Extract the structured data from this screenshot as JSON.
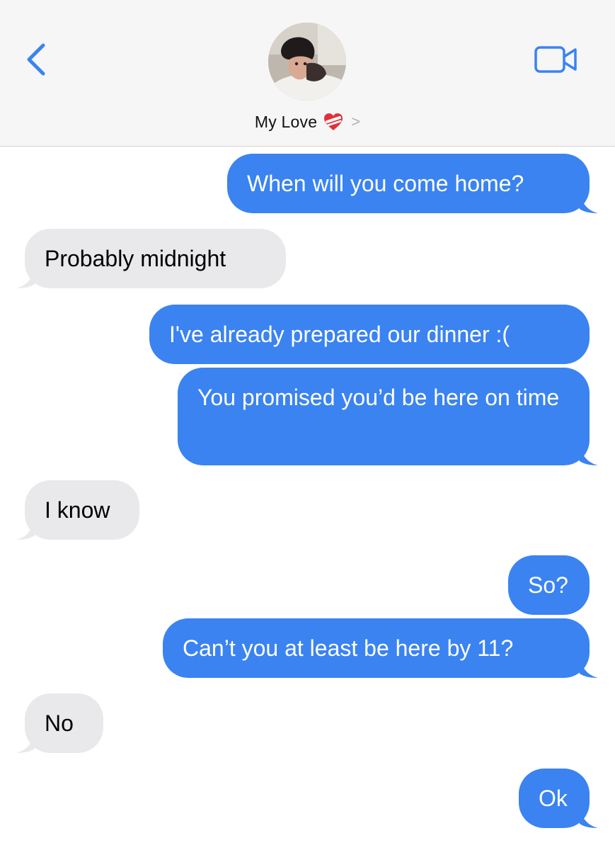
{
  "header": {
    "contact_name": "My Love",
    "back_icon": "chevron-left-icon",
    "video_icon": "video-camera-icon",
    "heart_icon": "mending-heart-emoji-icon",
    "disclosure_icon": "chevron-right-icon",
    "disclosure_glyph": ">",
    "accent_color": "#3a83f1"
  },
  "messages": [
    {
      "direction": "sent",
      "text": "When will you come home?"
    },
    {
      "direction": "received",
      "text": "Probably midnight"
    },
    {
      "direction": "sent",
      "text": "I've already prepared our dinner :("
    },
    {
      "direction": "sent",
      "text": "You promised you’d be here on time"
    },
    {
      "direction": "received",
      "text": "I know"
    },
    {
      "direction": "sent",
      "text": "So?"
    },
    {
      "direction": "sent",
      "text": "Can’t you at least be here by 11?"
    },
    {
      "direction": "received",
      "text": "No"
    },
    {
      "direction": "sent",
      "text": "Ok"
    }
  ],
  "colors": {
    "sent_bubble": "#3a83f1",
    "received_bubble": "#e9e9eb",
    "header_background": "#f6f6f6"
  }
}
